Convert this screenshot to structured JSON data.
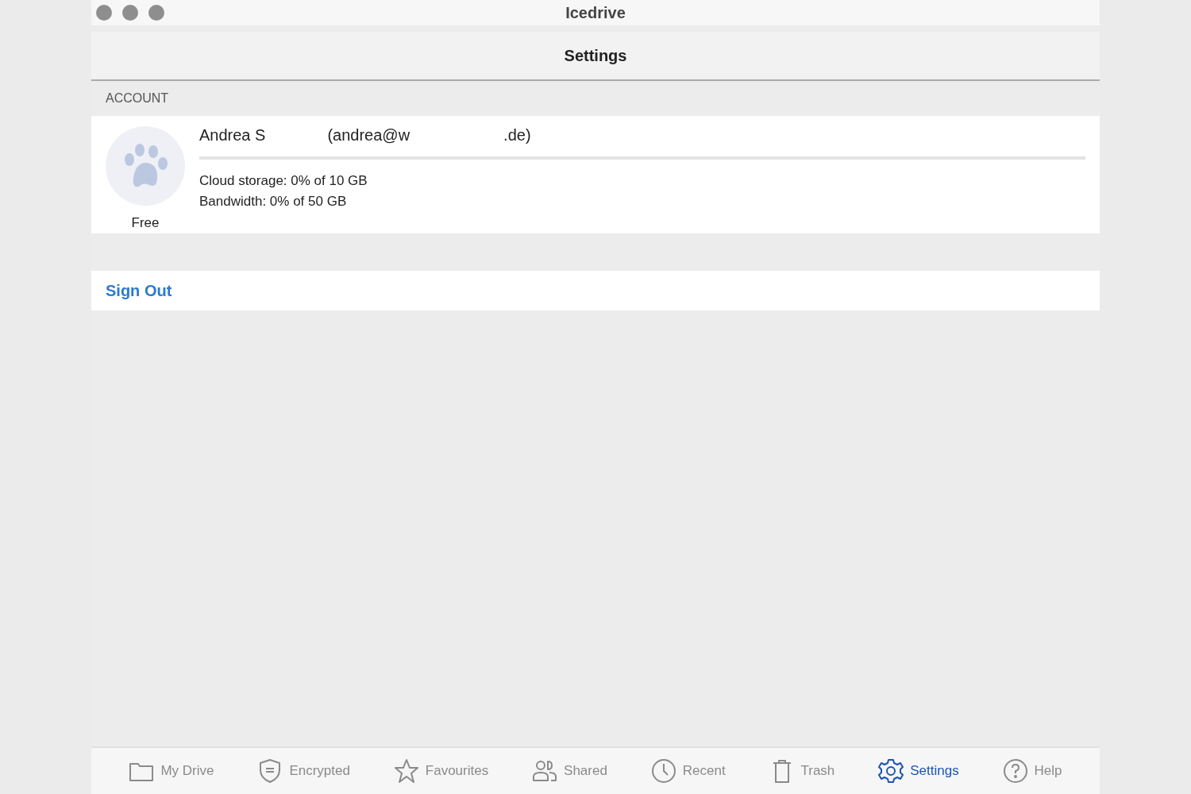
{
  "window": {
    "title": "Icedrive"
  },
  "header": {
    "title": "Settings"
  },
  "account": {
    "section_label": "ACCOUNT",
    "name": "Andrea S",
    "email_start": "(andrea@w",
    "email_end": ".de)",
    "plan": "Free",
    "lines": [
      "Cloud storage: 0% of 10 GB",
      "Bandwidth: 0% of 50 GB"
    ]
  },
  "sign_out": "Sign Out",
  "tabs": [
    {
      "label": "My Drive",
      "kind": "folder",
      "selected": false
    },
    {
      "label": "Encrypted",
      "kind": "shield",
      "selected": false
    },
    {
      "label": "Favourites",
      "kind": "star",
      "selected": false
    },
    {
      "label": "Shared",
      "kind": "people",
      "selected": false
    },
    {
      "label": "Recent",
      "kind": "clock",
      "selected": false
    },
    {
      "label": "Trash",
      "kind": "trash",
      "selected": false
    },
    {
      "label": "Settings",
      "kind": "gear",
      "selected": true
    },
    {
      "label": "Help",
      "kind": "help",
      "selected": false
    }
  ]
}
